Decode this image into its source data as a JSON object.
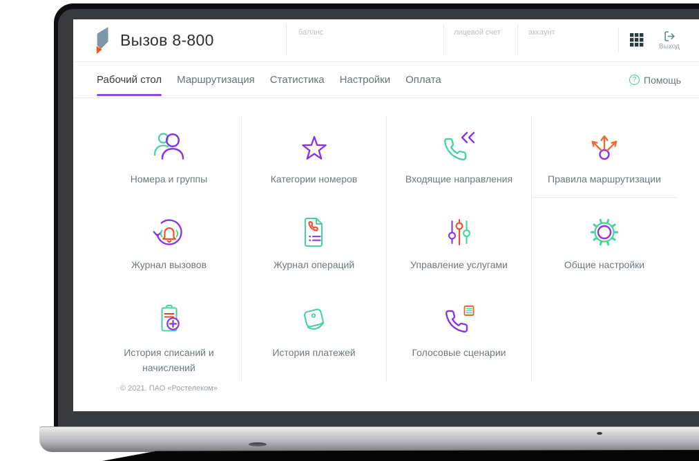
{
  "header": {
    "title": "Вызов 8-800",
    "fields": [
      {
        "label": "баланс"
      },
      {
        "label": "лицевой счет"
      },
      {
        "label": "аккаунт"
      }
    ],
    "logout_label": "Выход"
  },
  "nav": {
    "tabs": [
      {
        "label": "Рабочий стол",
        "active": true
      },
      {
        "label": "Маршрутизация",
        "active": false
      },
      {
        "label": "Статистика",
        "active": false
      },
      {
        "label": "Настройки",
        "active": false
      },
      {
        "label": "Оплата",
        "active": false
      }
    ],
    "help_label": "Помощь"
  },
  "tiles": [
    {
      "label": "Номера и группы",
      "icon": "users-icon"
    },
    {
      "label": "Категории номеров",
      "icon": "star-icon"
    },
    {
      "label": "Входящие направления",
      "icon": "incoming-call-icon"
    },
    {
      "label": "Правила маршрутизации",
      "icon": "routing-arrows-icon"
    },
    {
      "label": "Журнал вызовов",
      "icon": "call-log-icon"
    },
    {
      "label": "Журнал операций",
      "icon": "operations-log-icon"
    },
    {
      "label": "Управление услугами",
      "icon": "sliders-icon"
    },
    {
      "label": "Общие настройки",
      "icon": "gear-icon"
    },
    {
      "label": "История списаний и начислений",
      "icon": "charges-history-icon"
    },
    {
      "label": "История платежей",
      "icon": "payments-history-icon"
    },
    {
      "label": "Голосовые сценарии",
      "icon": "voice-scenarios-icon"
    }
  ],
  "footer": {
    "copyright": "© 2021. ПАО «Ростелеком»"
  },
  "colors": {
    "purple": "#8a33e5",
    "green": "#4ad1a2",
    "orange": "#ed6a2f",
    "red_orange": "#ee4b26",
    "tab_underline": "#8d48e8",
    "help_green": "#3ccf9f",
    "exit_teal": "#5e8686",
    "logo_blue": "#7e97a8",
    "logo_orange": "#f4561f"
  }
}
